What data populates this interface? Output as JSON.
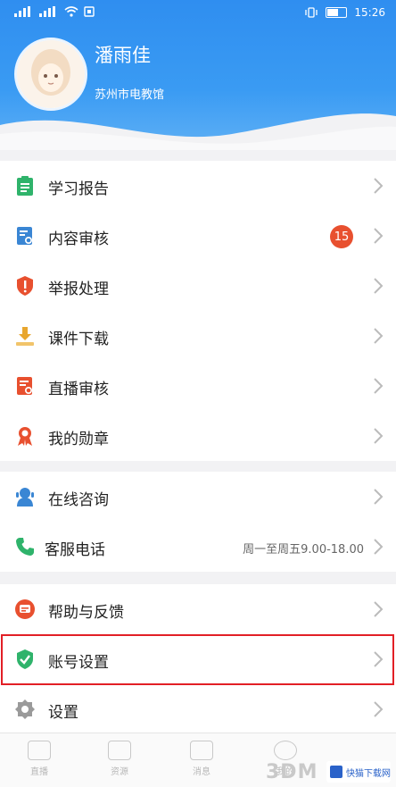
{
  "status_bar": {
    "left_indicators": [
      "signal-icon",
      "signal-icon",
      "wifi-icon",
      "sim-icon"
    ],
    "time": "15:26"
  },
  "profile": {
    "name": "潘雨佳",
    "org": "苏州市电教馆"
  },
  "menu_group_1": [
    {
      "id": "study-report",
      "label": "学习报告",
      "icon": "clipboard-icon",
      "color": "#2fb36b"
    },
    {
      "id": "content-review",
      "label": "内容审核",
      "icon": "review-doc-icon",
      "color": "#3a86d4",
      "badge": "15"
    },
    {
      "id": "report-handle",
      "label": "举报处理",
      "icon": "shield-alert-icon",
      "color": "#e8502f"
    },
    {
      "id": "courseware-download",
      "label": "课件下载",
      "icon": "download-icon",
      "color": "#e8a62e"
    },
    {
      "id": "live-review",
      "label": "直播审核",
      "icon": "live-doc-icon",
      "color": "#e8502f"
    },
    {
      "id": "my-medals",
      "label": "我的勋章",
      "icon": "medal-icon",
      "color": "#e8502f"
    }
  ],
  "menu_group_2": [
    {
      "id": "online-consult",
      "label": "在线咨询",
      "icon": "consult-icon",
      "color": "#3a86d4"
    },
    {
      "id": "service-phone",
      "label": "客服电话",
      "icon": "phone-icon",
      "color": "#2fb36b",
      "hours": "周一至周五9.00-18.00"
    }
  ],
  "menu_group_3": [
    {
      "id": "help-feedback",
      "label": "帮助与反馈",
      "icon": "feedback-icon",
      "color": "#e8502f"
    },
    {
      "id": "account-settings",
      "label": "账号设置",
      "icon": "shield-check-icon",
      "color": "#2fb36b"
    },
    {
      "id": "settings",
      "label": "设置",
      "icon": "gear-icon",
      "color": "#9a9a9a"
    }
  ],
  "tabbar": [
    "直播",
    "资源",
    "消息",
    "我的"
  ],
  "watermark": {
    "logo": "3DM",
    "site": "快猫下载网"
  },
  "colors": {
    "header": "#2f8ef0",
    "badge": "#e8502f",
    "highlight": "#e21f26"
  }
}
